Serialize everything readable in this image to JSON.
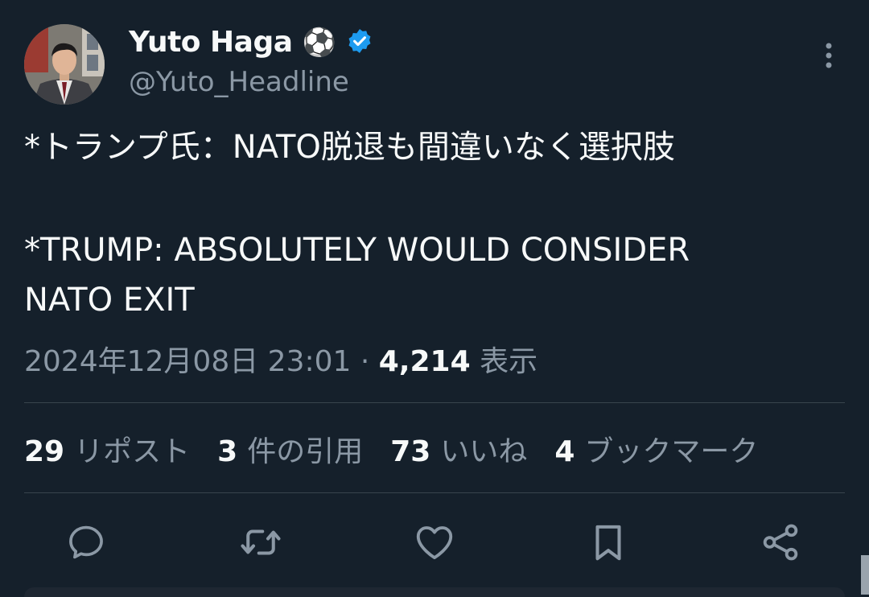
{
  "author": {
    "name": "Yuto Haga",
    "emoji": "⚽",
    "handle": "@Yuto_Headline",
    "verified": true
  },
  "tweet": {
    "text_jp": "*トランプ氏：NATO脱退も間違いなく選択肢",
    "text_en_line1": "*TRUMP: ABSOLUTELY WOULD CONSIDER",
    "text_en_line2": "NATO EXIT"
  },
  "meta": {
    "timestamp": "2024年12月08日 23:01",
    "separator": " · ",
    "views_count": "4,214",
    "views_label": "表示"
  },
  "stats": {
    "reposts_count": "29",
    "reposts_label": "リポスト",
    "quotes_count": "3",
    "quotes_label": "件の引用",
    "likes_count": "73",
    "likes_label": "いいね",
    "bookmarks_count": "4",
    "bookmarks_label": "ブックマーク"
  },
  "actions": [
    "reply-icon",
    "retweet-icon",
    "like-icon",
    "bookmark-icon",
    "share-icon"
  ],
  "colors": {
    "background": "#15202b",
    "text": "#f7f9f9",
    "secondary": "#8b98a5",
    "verified": "#1d9bf0",
    "divider": "#38444d"
  }
}
